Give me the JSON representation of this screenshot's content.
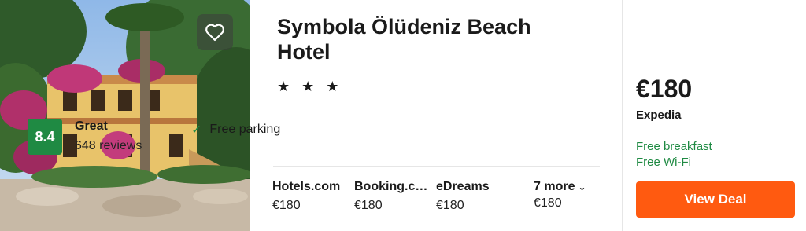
{
  "hotel": {
    "name": "Symbola Ölüdeniz Beach Hotel",
    "stars": "★ ★ ★",
    "star_count": 3
  },
  "rating": {
    "score": "8.4",
    "label": "Great",
    "reviews": "648 reviews",
    "color": "#1f8a43"
  },
  "amenities": [
    {
      "icon": "check-icon",
      "label": "Free parking"
    }
  ],
  "providers": [
    {
      "name": "Hotels.com",
      "price": "€180"
    },
    {
      "name": "Booking.com",
      "price": "€180"
    },
    {
      "name": "eDreams",
      "price": "€180"
    }
  ],
  "more": {
    "label": "7 more",
    "price": "€180"
  },
  "best": {
    "price": "€180",
    "source": "Expedia",
    "perks": [
      "Free breakfast",
      "Free Wi-Fi"
    ],
    "button": "View Deal",
    "button_color": "#ff5a10"
  }
}
